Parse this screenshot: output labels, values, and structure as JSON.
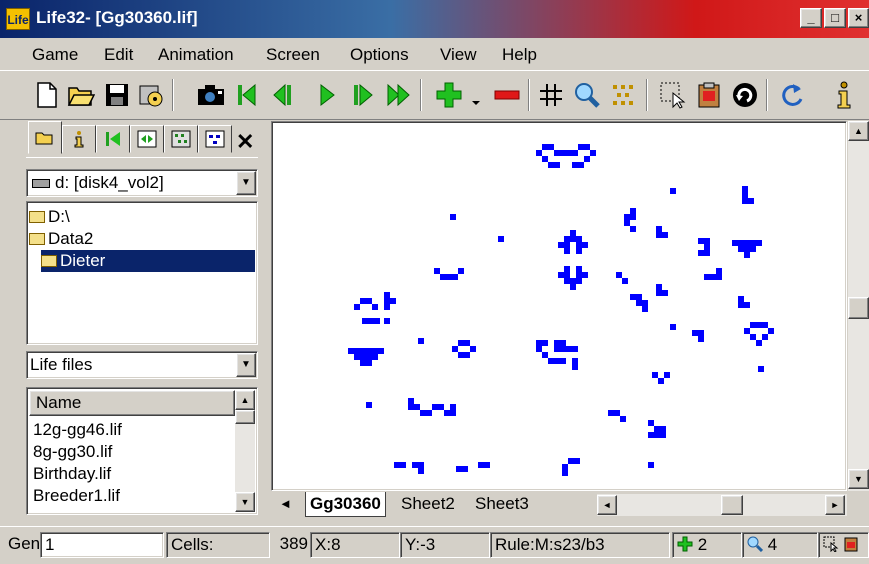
{
  "window": {
    "title": "Life32- [Gg30360.lif]",
    "app_icon_text": "Life",
    "controls": [
      "_",
      "□",
      "×"
    ]
  },
  "menu": [
    "Game",
    "Edit",
    "Animation",
    "Screen",
    "Options",
    "View",
    "Help"
  ],
  "toolbar": [
    {
      "name": "new-icon",
      "glyph": "🗋"
    },
    {
      "name": "open-icon",
      "glyph": "📂"
    },
    {
      "name": "save-icon",
      "glyph": "💾"
    },
    {
      "name": "settings-icon",
      "glyph": "⚙"
    },
    {
      "name": "camera-icon",
      "glyph": "📷"
    },
    {
      "name": "skip-start-icon",
      "glyph": "|◀"
    },
    {
      "name": "step-back-icon",
      "glyph": "◀|"
    },
    {
      "name": "play-icon",
      "glyph": "▶"
    },
    {
      "name": "step-forward-icon",
      "glyph": "|▶"
    },
    {
      "name": "fast-forward-icon",
      "glyph": "▶▶"
    },
    {
      "name": "zoom-in-plus-icon",
      "glyph": "+"
    },
    {
      "name": "zoom-out-minus-icon",
      "glyph": "−"
    },
    {
      "name": "grid-icon",
      "glyph": "#"
    },
    {
      "name": "magnifier-icon",
      "glyph": "🔍"
    },
    {
      "name": "pattern-icon",
      "glyph": "⁘"
    },
    {
      "name": "select-icon",
      "glyph": "⬚"
    },
    {
      "name": "paste-icon",
      "glyph": "📋"
    },
    {
      "name": "rotate-icon",
      "glyph": "↻"
    },
    {
      "name": "refresh-icon",
      "glyph": "↻"
    },
    {
      "name": "info-icon",
      "glyph": "i"
    }
  ],
  "left_panel": {
    "tabs": [
      "open-folder",
      "info",
      "start",
      "fit",
      "pattern",
      "dots"
    ],
    "drive": "d: [disk4_vol2]",
    "tree": [
      {
        "label": "D:\\",
        "indent": 0,
        "selected": false
      },
      {
        "label": "Data2",
        "indent": 0,
        "selected": false
      },
      {
        "label": "Dieter",
        "indent": 1,
        "selected": true
      }
    ],
    "filter": "Life files",
    "file_header": "Name",
    "files": [
      "12g-gg46.lif",
      "8g-gg30.lif",
      "Birthday.lif",
      "Breeder1.lif"
    ]
  },
  "sheets": [
    "Gg30360",
    "Sheet2",
    "Sheet3"
  ],
  "status": {
    "gen_label": "Gen:",
    "gen_value": "1",
    "cells_label": "Cells:",
    "cells_value": "389",
    "x_label": "X:",
    "x_value": "8",
    "y_label": "Y:",
    "y_value": "-3",
    "rule_label": "Rule:",
    "rule_value": "M:s23/b3",
    "plus_value": "2",
    "zoom_value": "4"
  },
  "colors": {
    "cell": "#0000ff",
    "canvas_bg": "#ffffff",
    "selection": "#0a246a"
  }
}
